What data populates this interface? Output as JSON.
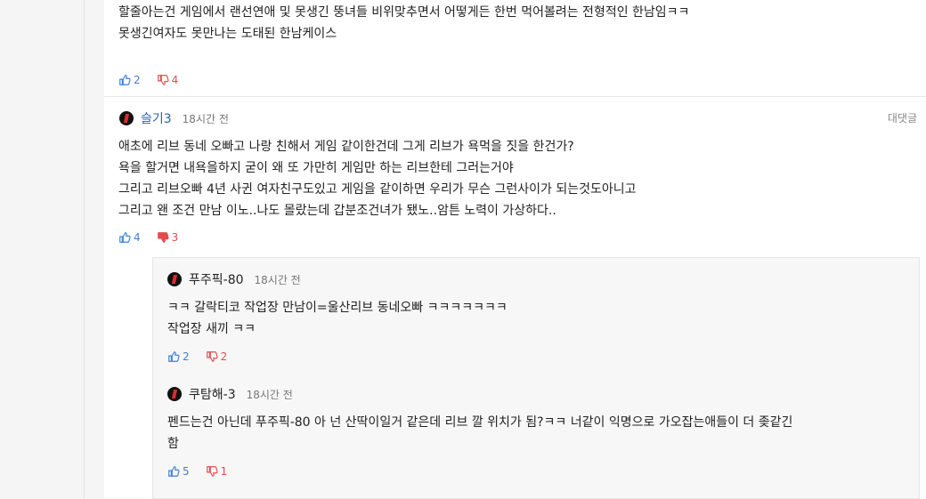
{
  "comment_top": {
    "lines": [
      "할줄아는건 게임에서 랜선연애 및 못생긴 뚱녀들 비위맞추면서 어떻게든 한번 먹어볼려는 전형적인 한남임ㅋㅋ",
      "못생긴여자도 못만나는 도태된 한남케이스"
    ],
    "likes": "2",
    "dislikes": "4"
  },
  "comment_main": {
    "nickname": "슬기3",
    "time": "18시간 전",
    "reply_label": "대댓글",
    "lines": [
      "애초에 리브 동네 오빠고 나랑 친해서 게임 같이한건데 그게 리브가 욕먹을 짓을 한건가?",
      "욕을 할거면 내욕을하지 굳이 왜 또 가만히 게임만 하는 리브한테 그러는거야",
      "그리고 리브오빠 4년 사귄 여자친구도있고 게임을 같이하면 우리가 무슨 그런사이가 되는것도아니고",
      "그리고 왠 조건 만남 이노..나도 몰랐는데 갑분조건녀가 됐노..암튼 노력이 가상하다.."
    ],
    "likes": "4",
    "dislikes": "3"
  },
  "reply_1": {
    "nickname": "푸주픽-80",
    "time": "18시간 전",
    "lines": [
      "ㅋㅋ 갈락티코 작업장 만남이=울산리브 동네오빠 ㅋㅋㅋㅋㅋㅋㅋ",
      "작업장 새끼 ㅋㅋ"
    ],
    "likes": "2",
    "dislikes": "2"
  },
  "reply_2": {
    "nickname": "쿠탐해-3",
    "time": "18시간 전",
    "lines": [
      "펜드는건 아닌데 푸주픽-80 아 넌 산딱이일거 같은데 리브 깔 위치가 됨?ㅋㅋ 너같이 익명으로 가오잡는애들이 더 좆같긴",
      "함"
    ],
    "likes": "5",
    "dislikes": "1"
  },
  "colors": {
    "like": "#3d7fd6",
    "dislike": "#e14c4c",
    "nickname": "#2b5fb0"
  }
}
